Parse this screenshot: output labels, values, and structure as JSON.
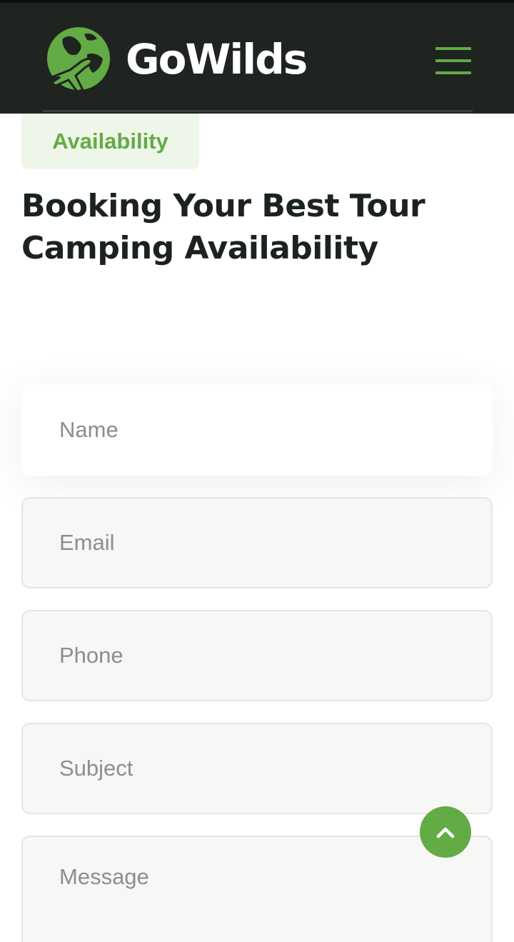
{
  "header": {
    "brand": "GoWilds",
    "logo_icon": "globe-airplane-icon",
    "menu_icon": "hamburger-menu-icon"
  },
  "section": {
    "badge": "Availability",
    "title_line1": "Booking Your Best Tour",
    "title_line2": "Camping Availability"
  },
  "form": {
    "name_placeholder": "Name",
    "email_placeholder": "Email",
    "phone_placeholder": "Phone",
    "subject_placeholder": "Subject",
    "message_placeholder": "Message"
  },
  "scroll_top": {
    "icon": "chevron-up-icon"
  },
  "colors": {
    "accent": "#63ab45",
    "header_bg": "#1f2420",
    "heading": "#1c231f",
    "field_bg": "#f7f7f5",
    "badge_bg": "#eef6e9"
  }
}
